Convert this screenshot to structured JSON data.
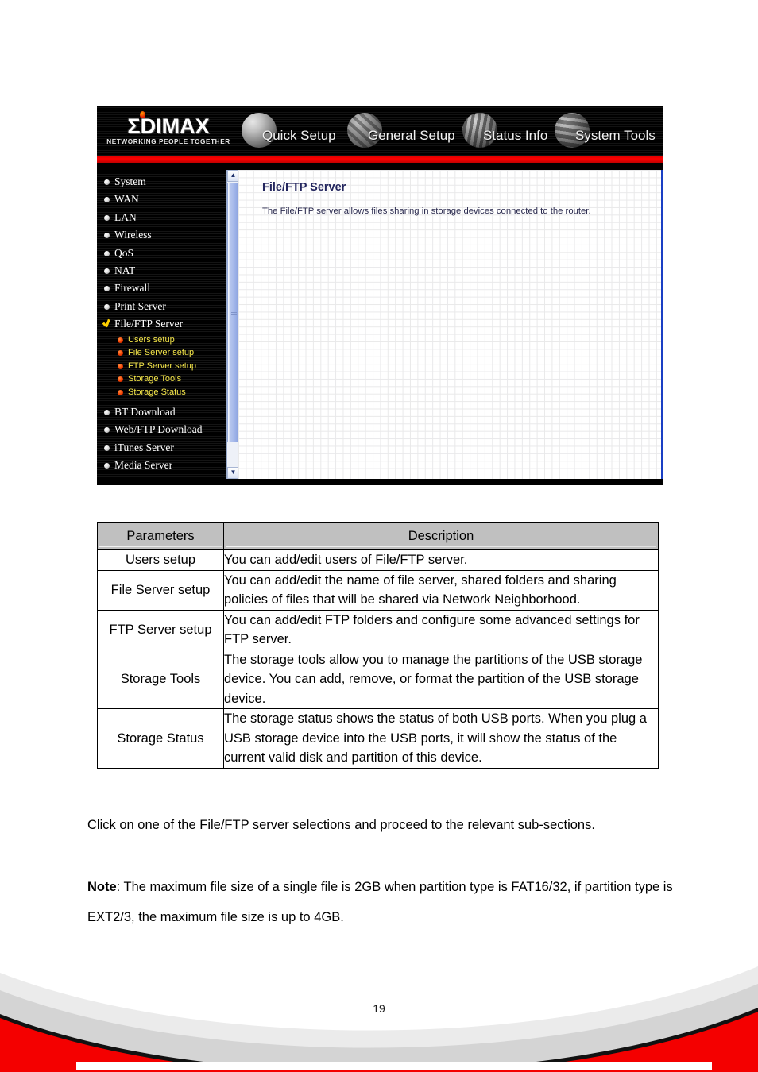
{
  "router_ui": {
    "logo": {
      "wordmark": "ΣDIMAX",
      "tagline": "NETWORKING PEOPLE TOGETHER"
    },
    "nav_tabs": [
      {
        "label": "Quick Setup",
        "icon": "metallic-orb-icon"
      },
      {
        "label": "General Setup",
        "icon": "metallic-orb-icon"
      },
      {
        "label": "Status Info",
        "icon": "metallic-orb-icon"
      },
      {
        "label": "System Tools",
        "icon": "metallic-orb-icon"
      }
    ],
    "sidebar": {
      "items": [
        {
          "label": "System",
          "type": "item"
        },
        {
          "label": "WAN",
          "type": "item"
        },
        {
          "label": "LAN",
          "type": "item"
        },
        {
          "label": "Wireless",
          "type": "item"
        },
        {
          "label": "QoS",
          "type": "item"
        },
        {
          "label": "NAT",
          "type": "item"
        },
        {
          "label": "Firewall",
          "type": "item"
        },
        {
          "label": "Print Server",
          "type": "item"
        },
        {
          "label": "File/FTP Server",
          "type": "item",
          "selected": true
        },
        {
          "label": "Users setup",
          "type": "sub"
        },
        {
          "label": "File Server setup",
          "type": "sub"
        },
        {
          "label": "FTP Server setup",
          "type": "sub"
        },
        {
          "label": "Storage Tools",
          "type": "sub"
        },
        {
          "label": "Storage Status",
          "type": "sub"
        },
        {
          "label": "BT Download",
          "type": "item"
        },
        {
          "label": "Web/FTP Download",
          "type": "item"
        },
        {
          "label": "iTunes Server",
          "type": "item"
        },
        {
          "label": "Media Server",
          "type": "item"
        }
      ]
    },
    "content": {
      "title": "File/FTP Server",
      "description": "The File/FTP server allows files sharing in storage devices connected to the router."
    },
    "colors": {
      "accent_red": "#ff0000",
      "header_black": "#000000",
      "sub_item_yellow": "#f5e64a",
      "panel_border_blue": "#1a3fc4",
      "title_navy": "#23265e"
    }
  },
  "param_table": {
    "headers": [
      "Parameters",
      "Description"
    ],
    "rows": [
      {
        "parameter": "Users setup",
        "description": "You can add/edit users of File/FTP server."
      },
      {
        "parameter": "File Server setup",
        "description": "You can add/edit the name of file server, shared folders and sharing policies of files that will be shared via Network Neighborhood."
      },
      {
        "parameter": "FTP Server setup",
        "description": "You can add/edit FTP folders and configure some advanced settings for FTP server."
      },
      {
        "parameter": "Storage Tools",
        "description": "The storage tools allow you to manage the partitions of the USB storage device. You can add, remove, or format the partition of the USB storage device."
      },
      {
        "parameter": "Storage Status",
        "description": "The storage status shows the status of both USB ports. When you plug a USB storage device into the USB ports, it will show the status of the current valid disk and partition of this device."
      }
    ]
  },
  "body": {
    "click_paragraph": "Click on one of the File/FTP server selections and proceed to the relevant sub-sections.",
    "note_label": "Note",
    "note_text": ": The maximum file size of a single file is 2GB when partition type is FAT16/32, if partition type is EXT2/3, the maximum file size is up to 4GB."
  },
  "footer": {
    "page_number": "19",
    "band_red": "#f40000",
    "band_gray_light": "#ebebeb",
    "band_gray": "#d4d4d4"
  }
}
